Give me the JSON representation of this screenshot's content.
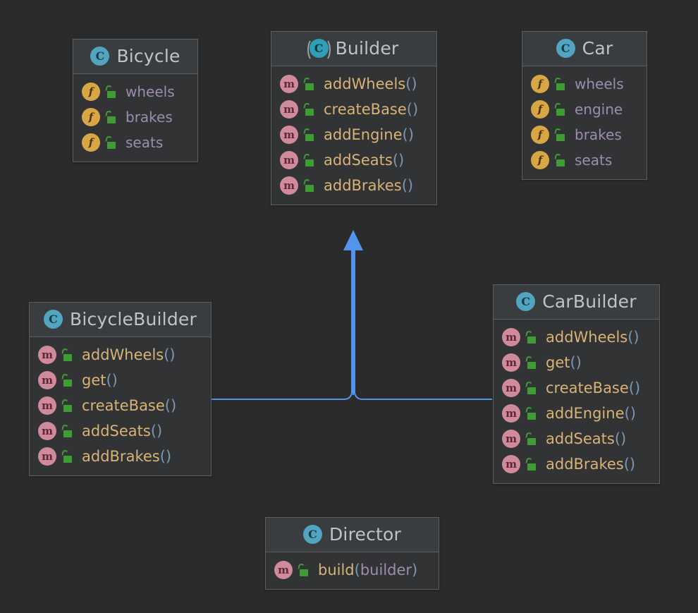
{
  "diagram": {
    "type": "uml-class-diagram",
    "background_color": "#2b2b2b",
    "connector_color": "#5394ec",
    "icons": {
      "class": "class-icon",
      "abstract_class": "abstract-class-icon",
      "field": "field-icon",
      "method": "method-icon",
      "visibility": "unlocked-padlock-icon"
    },
    "colors": {
      "box_background": "#313335",
      "header_background": "#3a3d3f",
      "border": "#5c5f61",
      "title_text": "#bdc3c7",
      "field_text": "#9d8cb0",
      "method_text": "#d9b376",
      "paren_text": "#7a97b5",
      "class_badge": "#51a5c0",
      "field_badge": "#d9a645",
      "method_badge": "#cf8a9b",
      "lock_green": "#3f9c35"
    }
  },
  "classes": {
    "bicycle": {
      "name": "Bicycle",
      "stereotype": "class",
      "members": [
        {
          "kind": "field",
          "name": "wheels",
          "visibility": "public"
        },
        {
          "kind": "field",
          "name": "brakes",
          "visibility": "public"
        },
        {
          "kind": "field",
          "name": "seats",
          "visibility": "public"
        }
      ]
    },
    "builder": {
      "name": "Builder",
      "stereotype": "abstract-class",
      "members": [
        {
          "kind": "method",
          "name": "addWheels",
          "visibility": "public"
        },
        {
          "kind": "method",
          "name": "createBase",
          "visibility": "public"
        },
        {
          "kind": "method",
          "name": "addEngine",
          "visibility": "public"
        },
        {
          "kind": "method",
          "name": "addSeats",
          "visibility": "public"
        },
        {
          "kind": "method",
          "name": "addBrakes",
          "visibility": "public"
        }
      ]
    },
    "car": {
      "name": "Car",
      "stereotype": "class",
      "members": [
        {
          "kind": "field",
          "name": "wheels",
          "visibility": "public"
        },
        {
          "kind": "field",
          "name": "engine",
          "visibility": "public"
        },
        {
          "kind": "field",
          "name": "brakes",
          "visibility": "public"
        },
        {
          "kind": "field",
          "name": "seats",
          "visibility": "public"
        }
      ]
    },
    "bicycleBuilder": {
      "name": "BicycleBuilder",
      "stereotype": "class",
      "members": [
        {
          "kind": "method",
          "name": "addWheels",
          "visibility": "public"
        },
        {
          "kind": "method",
          "name": "get",
          "visibility": "public"
        },
        {
          "kind": "method",
          "name": "createBase",
          "visibility": "public"
        },
        {
          "kind": "method",
          "name": "addSeats",
          "visibility": "public"
        },
        {
          "kind": "method",
          "name": "addBrakes",
          "visibility": "public"
        }
      ]
    },
    "carBuilder": {
      "name": "CarBuilder",
      "stereotype": "class",
      "members": [
        {
          "kind": "method",
          "name": "addWheels",
          "visibility": "public"
        },
        {
          "kind": "method",
          "name": "get",
          "visibility": "public"
        },
        {
          "kind": "method",
          "name": "createBase",
          "visibility": "public"
        },
        {
          "kind": "method",
          "name": "addEngine",
          "visibility": "public"
        },
        {
          "kind": "method",
          "name": "addSeats",
          "visibility": "public"
        },
        {
          "kind": "method",
          "name": "addBrakes",
          "visibility": "public"
        }
      ]
    },
    "director": {
      "name": "Director",
      "stereotype": "class",
      "members": [
        {
          "kind": "method",
          "name": "build",
          "visibility": "public",
          "params": "builder"
        }
      ]
    }
  },
  "badge_labels": {
    "class": "C",
    "abstract_class": "C",
    "field": "f",
    "method": "m"
  },
  "relationships": [
    {
      "from": "BicycleBuilder",
      "to": "Builder",
      "type": "generalization",
      "arrow": "hollow-triangle-filled"
    },
    {
      "from": "CarBuilder",
      "to": "Builder",
      "type": "generalization",
      "arrow": "hollow-triangle-filled"
    }
  ]
}
